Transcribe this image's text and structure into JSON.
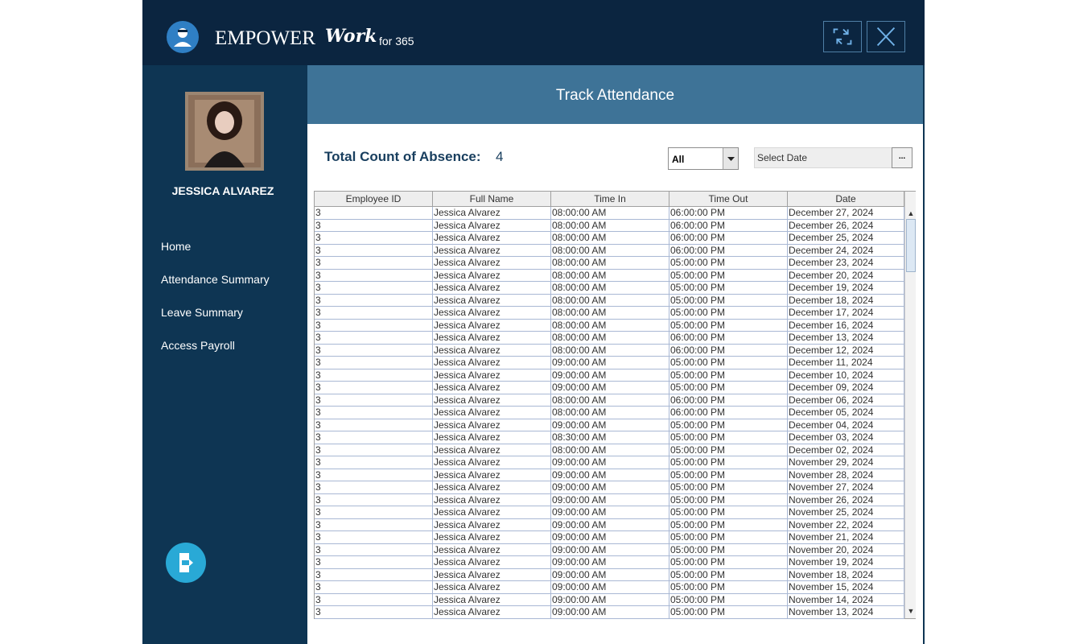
{
  "header": {
    "brand": "EMPOWER",
    "brand_work": "Work",
    "brand_sub": "for 365"
  },
  "user": {
    "name": "JESSICA ALVAREZ"
  },
  "nav": [
    "Home",
    "Attendance Summary",
    "Leave Summary",
    "Access Payroll"
  ],
  "page": {
    "title": "Track Attendance"
  },
  "absence": {
    "label": "Total Count of Absence:",
    "value": "4"
  },
  "filter": {
    "value": "All"
  },
  "date": {
    "placeholder": "Select Date",
    "button": "..."
  },
  "table": {
    "columns": [
      "Employee ID",
      "Full Name",
      "Time In",
      "Time Out",
      "Date"
    ],
    "rows": [
      [
        "3",
        "Jessica Alvarez",
        "08:00:00 AM",
        "06:00:00 PM",
        "December 27, 2024"
      ],
      [
        "3",
        "Jessica Alvarez",
        "08:00:00 AM",
        "06:00:00 PM",
        "December 26, 2024"
      ],
      [
        "3",
        "Jessica Alvarez",
        "08:00:00 AM",
        "06:00:00 PM",
        "December 25, 2024"
      ],
      [
        "3",
        "Jessica Alvarez",
        "08:00:00 AM",
        "06:00:00 PM",
        "December 24, 2024"
      ],
      [
        "3",
        "Jessica Alvarez",
        "08:00:00 AM",
        "05:00:00 PM",
        "December 23, 2024"
      ],
      [
        "3",
        "Jessica Alvarez",
        "08:00:00 AM",
        "05:00:00 PM",
        "December 20, 2024"
      ],
      [
        "3",
        "Jessica Alvarez",
        "08:00:00 AM",
        "05:00:00 PM",
        "December 19, 2024"
      ],
      [
        "3",
        "Jessica Alvarez",
        "08:00:00 AM",
        "05:00:00 PM",
        "December 18, 2024"
      ],
      [
        "3",
        "Jessica Alvarez",
        "08:00:00 AM",
        "05:00:00 PM",
        "December 17, 2024"
      ],
      [
        "3",
        "Jessica Alvarez",
        "08:00:00 AM",
        "05:00:00 PM",
        "December 16, 2024"
      ],
      [
        "3",
        "Jessica Alvarez",
        "08:00:00 AM",
        "06:00:00 PM",
        "December 13, 2024"
      ],
      [
        "3",
        "Jessica Alvarez",
        "08:00:00 AM",
        "06:00:00 PM",
        "December 12, 2024"
      ],
      [
        "3",
        "Jessica Alvarez",
        "09:00:00 AM",
        "05:00:00 PM",
        "December 11, 2024"
      ],
      [
        "3",
        "Jessica Alvarez",
        "09:00:00 AM",
        "05:00:00 PM",
        "December 10, 2024"
      ],
      [
        "3",
        "Jessica Alvarez",
        "09:00:00 AM",
        "05:00:00 PM",
        "December 09, 2024"
      ],
      [
        "3",
        "Jessica Alvarez",
        "08:00:00 AM",
        "06:00:00 PM",
        "December 06, 2024"
      ],
      [
        "3",
        "Jessica Alvarez",
        "08:00:00 AM",
        "06:00:00 PM",
        "December 05, 2024"
      ],
      [
        "3",
        "Jessica Alvarez",
        "09:00:00 AM",
        "05:00:00 PM",
        "December 04, 2024"
      ],
      [
        "3",
        "Jessica Alvarez",
        "08:30:00 AM",
        "05:00:00 PM",
        "December 03, 2024"
      ],
      [
        "3",
        "Jessica Alvarez",
        "08:00:00 AM",
        "05:00:00 PM",
        "December 02, 2024"
      ],
      [
        "3",
        "Jessica Alvarez",
        "09:00:00 AM",
        "05:00:00 PM",
        "November 29, 2024"
      ],
      [
        "3",
        "Jessica Alvarez",
        "09:00:00 AM",
        "05:00:00 PM",
        "November 28, 2024"
      ],
      [
        "3",
        "Jessica Alvarez",
        "09:00:00 AM",
        "05:00:00 PM",
        "November 27, 2024"
      ],
      [
        "3",
        "Jessica Alvarez",
        "09:00:00 AM",
        "05:00:00 PM",
        "November 26, 2024"
      ],
      [
        "3",
        "Jessica Alvarez",
        "09:00:00 AM",
        "05:00:00 PM",
        "November 25, 2024"
      ],
      [
        "3",
        "Jessica Alvarez",
        "09:00:00 AM",
        "05:00:00 PM",
        "November 22, 2024"
      ],
      [
        "3",
        "Jessica Alvarez",
        "09:00:00 AM",
        "05:00:00 PM",
        "November 21, 2024"
      ],
      [
        "3",
        "Jessica Alvarez",
        "09:00:00 AM",
        "05:00:00 PM",
        "November 20, 2024"
      ],
      [
        "3",
        "Jessica Alvarez",
        "09:00:00 AM",
        "05:00:00 PM",
        "November 19, 2024"
      ],
      [
        "3",
        "Jessica Alvarez",
        "09:00:00 AM",
        "05:00:00 PM",
        "November 18, 2024"
      ],
      [
        "3",
        "Jessica Alvarez",
        "09:00:00 AM",
        "05:00:00 PM",
        "November 15, 2024"
      ],
      [
        "3",
        "Jessica Alvarez",
        "09:00:00 AM",
        "05:00:00 PM",
        "November 14, 2024"
      ],
      [
        "3",
        "Jessica Alvarez",
        "09:00:00 AM",
        "05:00:00 PM",
        "November 13, 2024"
      ]
    ]
  }
}
